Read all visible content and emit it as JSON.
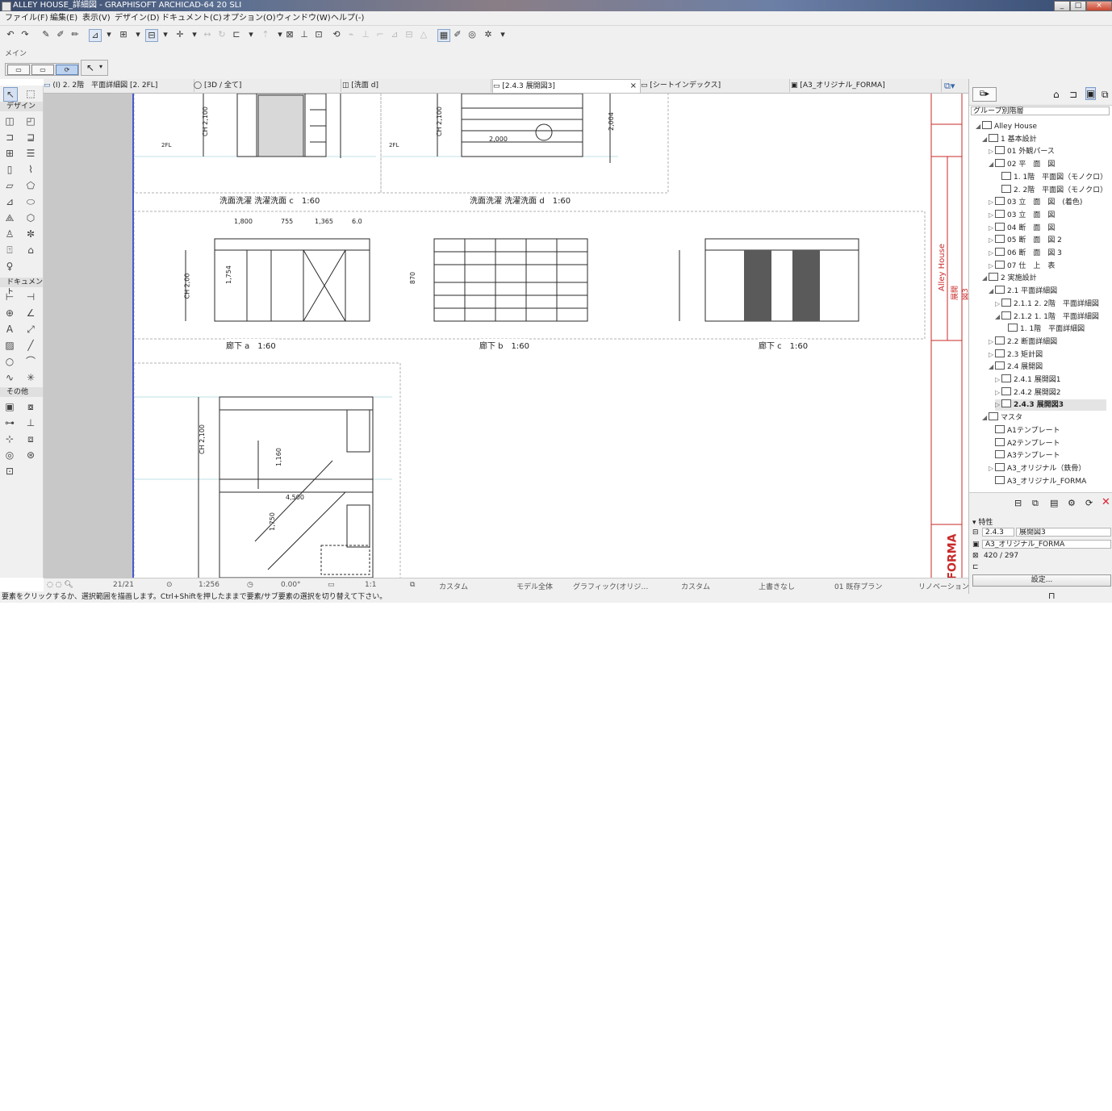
{
  "window": {
    "title": "ALLEY HOUSE_詳細図 - GRAPHISOFT ARCHICAD-64 20 SLI",
    "buttons": [
      "_",
      "□",
      "×"
    ]
  },
  "menu": [
    "ファイル(F)",
    "編集(E)",
    "表示(V)",
    "デザイン(D)",
    "ドキュメント(C)",
    "オプション(O)",
    "ウィンドウ(W)",
    "ヘルプ(-)"
  ],
  "toolbar2": {
    "label": "メイン"
  },
  "tabs": [
    {
      "label": "(I) 2. 2階　平面詳細図 [2. 2FL]",
      "active": false
    },
    {
      "label": "[3D / 全て]",
      "active": false
    },
    {
      "label": "[洗面 d]",
      "active": false
    },
    {
      "label": "[2.4.3 展開図3]",
      "active": true
    },
    {
      "label": "[シートインデックス]",
      "active": false
    },
    {
      "label": "[A3_オリジナル_FORMA]",
      "active": false
    }
  ],
  "toolbox": {
    "sections": [
      "デザイン",
      "ドキュメント",
      "その他"
    ]
  },
  "drawings": {
    "labels": [
      "洗面洗濯 洗濯洗面 c　1:60",
      "洗面洗濯 洗濯洗面 d　1:60",
      "廊下 a　1:60",
      "廊下 b　1:60",
      "廊下 c　1:60"
    ],
    "dims": [
      "1,800",
      "755",
      "1,365",
      "6.0",
      "2,000",
      "4,500",
      "CH 2,100",
      "CH 2,100",
      "CH 2,00",
      "CH 2,100",
      "2FL",
      "2FL",
      "1,160",
      "1,750",
      "2,004",
      "870",
      "1,754"
    ]
  },
  "titleblock": {
    "project": "Alley House",
    "brand": "FORMA",
    "sheet": "展開図3"
  },
  "status": {
    "coords": "21/21",
    "scale": "1:256",
    "angle": "0.00°",
    "ratio": "1:1",
    "layer": "カスタム",
    "model": "モデル全体",
    "graphic": "グラフィック(オリジ…",
    "pen": "カスタム",
    "override": "上書きなし",
    "plan": "01 既存プラン",
    "renov": "リノベーション"
  },
  "hint": "要素をクリックするか、選択範囲を描画します。Ctrl+Shiftを押したままで要素/サブ要素の選択を切り替えて下さい。",
  "navigator": {
    "header": "グループ別階層",
    "items": [
      {
        "label": "Alley House",
        "indent": 0,
        "arrow": "◢"
      },
      {
        "label": "1 基本設計",
        "indent": 1,
        "arrow": "◢"
      },
      {
        "label": "01 外観パース",
        "indent": 2,
        "arrow": "▷"
      },
      {
        "label": "02 平　面　図",
        "indent": 2,
        "arrow": "◢"
      },
      {
        "label": "1. 1階　平面図（モノクロ）",
        "indent": 3,
        "arrow": ""
      },
      {
        "label": "2. 2階　平面図（モノクロ）",
        "indent": 3,
        "arrow": ""
      },
      {
        "label": "03 立　面　図　(着色)",
        "indent": 2,
        "arrow": "▷"
      },
      {
        "label": "03 立　面　図",
        "indent": 2,
        "arrow": "▷"
      },
      {
        "label": "04 断　面　図",
        "indent": 2,
        "arrow": "▷"
      },
      {
        "label": "05 断　面　図 2",
        "indent": 2,
        "arrow": "▷"
      },
      {
        "label": "06 断　面　図 3",
        "indent": 2,
        "arrow": "▷"
      },
      {
        "label": "07 仕　上　表",
        "indent": 2,
        "arrow": "▷"
      },
      {
        "label": "2 実施設計",
        "indent": 1,
        "arrow": "◢"
      },
      {
        "label": "2.1 平面詳細図",
        "indent": 2,
        "arrow": "◢"
      },
      {
        "label": "2.1.1 2. 2階　平面詳細図",
        "indent": 3,
        "arrow": "▷"
      },
      {
        "label": "2.1.2 1. 1階　平面詳細図",
        "indent": 3,
        "arrow": "◢"
      },
      {
        "label": "1. 1階　平面詳細図",
        "indent": 4,
        "arrow": ""
      },
      {
        "label": "2.2 断面詳細図",
        "indent": 2,
        "arrow": "▷"
      },
      {
        "label": "2.3 矩計図",
        "indent": 2,
        "arrow": "▷"
      },
      {
        "label": "2.4 展開図",
        "indent": 2,
        "arrow": "◢"
      },
      {
        "label": "2.4.1 展開図1",
        "indent": 3,
        "arrow": "▷"
      },
      {
        "label": "2.4.2 展開図2",
        "indent": 3,
        "arrow": "▷"
      },
      {
        "label": "2.4.3 展開図3",
        "indent": 3,
        "arrow": "▷"
      },
      {
        "label": "マスタ",
        "indent": 1,
        "arrow": "◢"
      },
      {
        "label": "A1テンプレート",
        "indent": 2,
        "arrow": ""
      },
      {
        "label": "A2テンプレート",
        "indent": 2,
        "arrow": ""
      },
      {
        "label": "A3テンプレート",
        "indent": 2,
        "arrow": ""
      },
      {
        "label": "A3_オリジナル（鉄骨）",
        "indent": 2,
        "arrow": "▷"
      },
      {
        "label": "A3_オリジナル_FORMA",
        "indent": 2,
        "arrow": ""
      }
    ]
  },
  "properties": {
    "header": "特性",
    "id": "2.4.3",
    "name": "展開図3",
    "master": "A3_オリジナル_FORMA",
    "size": "420 / 297",
    "settings_button": "設定..."
  }
}
